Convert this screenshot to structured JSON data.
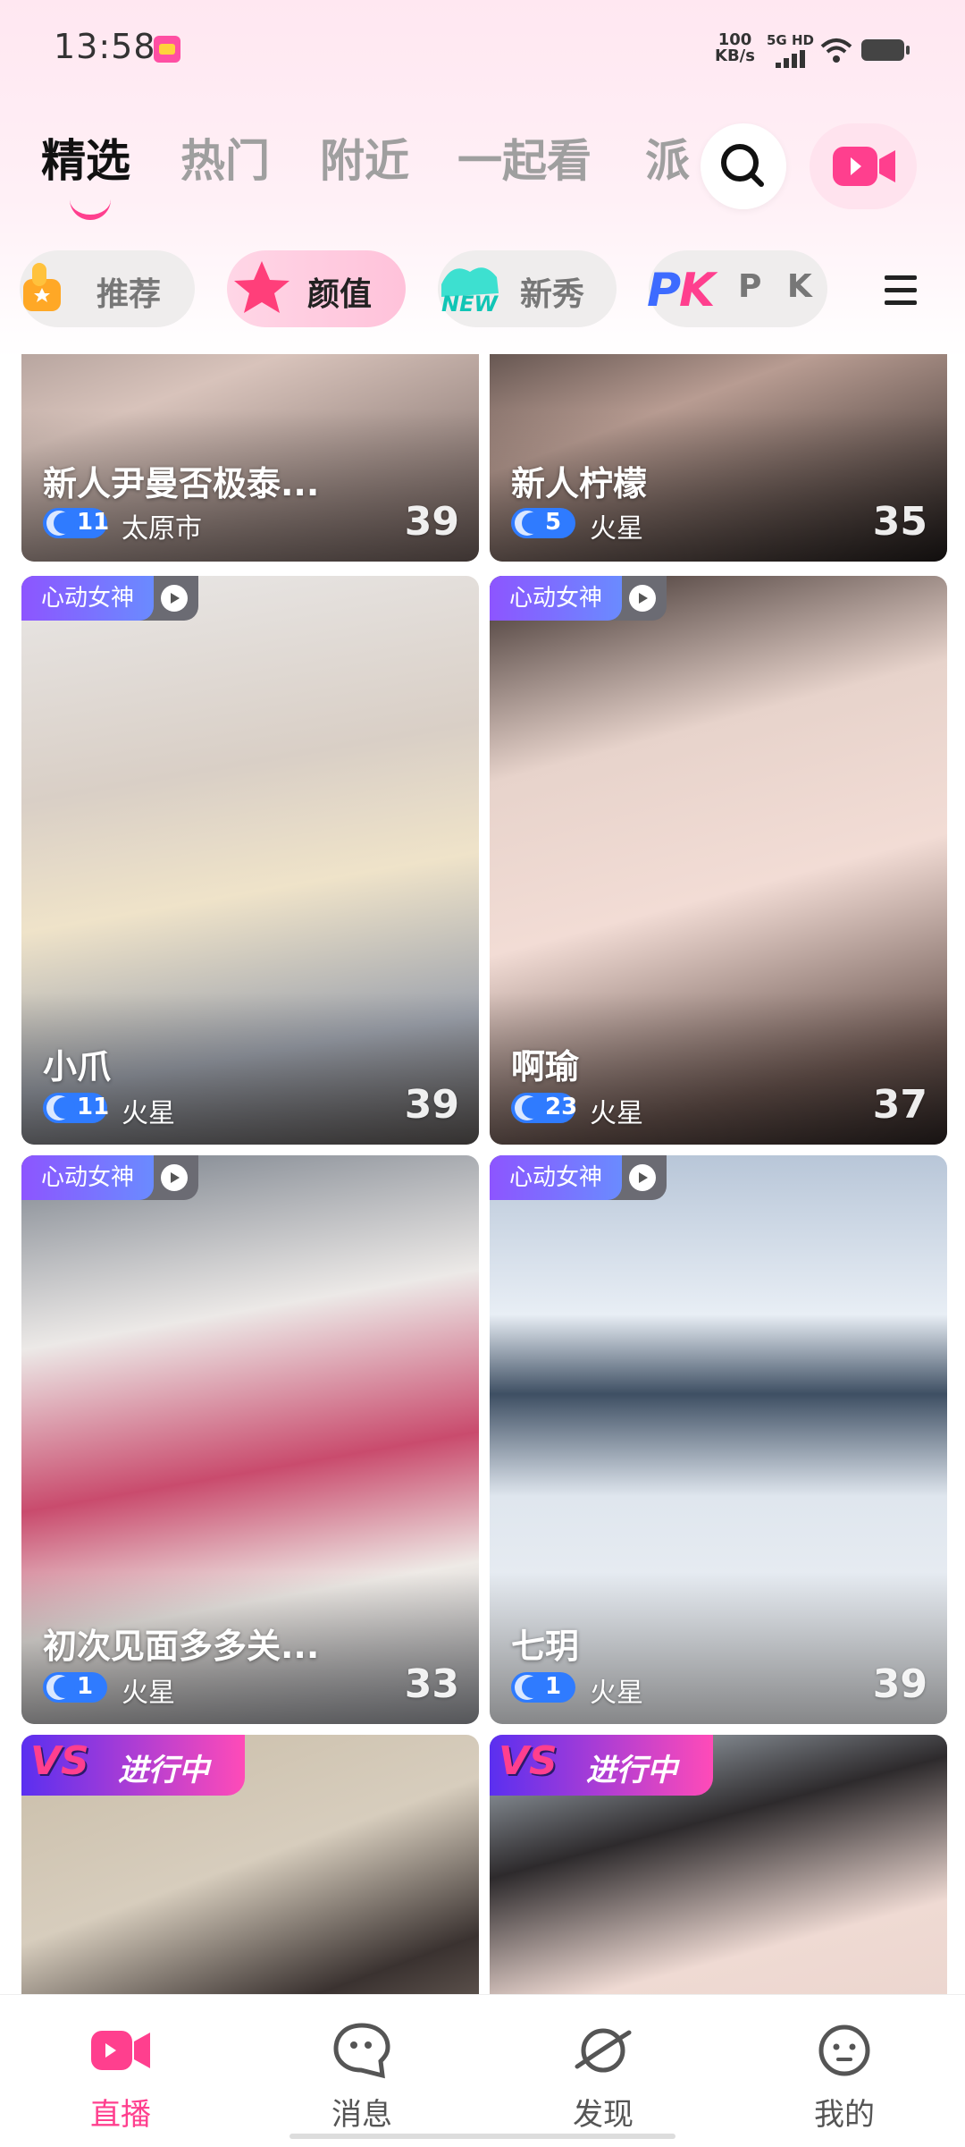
{
  "status_bar": {
    "time": "13:58",
    "net_speed_value": "100",
    "net_speed_unit": "KB/s",
    "network": "5G HD"
  },
  "top_tabs": [
    "精选",
    "热门",
    "附近",
    "一起看",
    "派"
  ],
  "categories": [
    {
      "label": "推荐",
      "icon": "thumbs-up-icon"
    },
    {
      "label": "颜值",
      "icon": "star-icon",
      "active": true
    },
    {
      "label": "新秀",
      "icon": "new-icon"
    },
    {
      "label": "P K",
      "icon": "pk-icon"
    }
  ],
  "cards": [
    {
      "title": "新人尹曼否极泰...",
      "level": "11",
      "location": "太原市",
      "count": "39"
    },
    {
      "title": "新人柠檬",
      "level": "5",
      "location": "火星",
      "count": "35"
    },
    {
      "badge": "心动女神",
      "title": "小爪",
      "level": "11",
      "location": "火星",
      "count": "39"
    },
    {
      "badge": "心动女神",
      "title": "啊瑜",
      "level": "23",
      "location": "火星",
      "count": "37"
    },
    {
      "badge": "心动女神",
      "title": "初次见面多多关...",
      "level": "1",
      "location": "火星",
      "count": "33"
    },
    {
      "badge": "心动女神",
      "title": "七玥",
      "level": "1",
      "location": "火星",
      "count": "39"
    },
    {
      "vs_mark": "VS",
      "vs_label": "进行中"
    },
    {
      "vs_mark": "VS",
      "vs_label": "进行中"
    }
  ],
  "bottom_nav": [
    {
      "label": "直播",
      "icon": "live-camera-icon",
      "active": true
    },
    {
      "label": "消息",
      "icon": "message-bubble-icon"
    },
    {
      "label": "发现",
      "icon": "planet-icon"
    },
    {
      "label": "我的",
      "icon": "profile-face-icon"
    }
  ],
  "colors": {
    "accent": "#ff3f8e",
    "level_badge": "#2f7bff",
    "badge_purple": "#8d55ff"
  }
}
